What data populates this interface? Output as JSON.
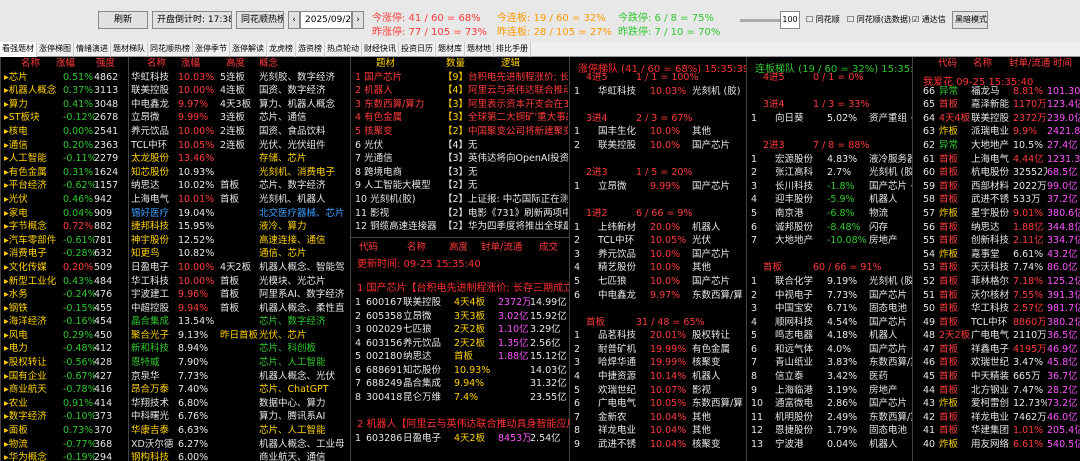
{
  "toolbar": {
    "refresh": "刷新",
    "countdown": "开盘倒计时: 17:38:13",
    "sync": "同花顺热榜",
    "date": "2025/09/25",
    "slider_value": "100",
    "cb1": "同花顺",
    "cb2": "同花顺(选数据)",
    "cb3": "通达信",
    "theme": "黑暗模式"
  },
  "stats": {
    "zt_today": "今涨停: 41 / 60 = 68%",
    "zt_yest": "昨涨停: 77 / 105 = 73%",
    "lb_today": "今连板: 19 / 60 = 32%",
    "lb_yest": "昨连板: 28 / 105 = 27%",
    "dt_today": "今跌停: 6 / 8 = 75%",
    "dt_yest": "昨跌停: 7 / 10 = 70%"
  },
  "tabs": [
    "看强题材",
    "涨停梯图",
    "情绪演进",
    "题材梯队",
    "同花顺热榜",
    "涨停季节",
    "涨停解读",
    "龙虎榜",
    "游资榜",
    "热点轮动",
    "财经快讯",
    "投资日历",
    "题材库",
    "题材地",
    "排比手册"
  ],
  "p1": {
    "headers": [
      "名称",
      "涨幅",
      "强度"
    ],
    "rows": [
      [
        "芯片",
        "0.51%",
        "4862",
        "y",
        "g"
      ],
      [
        "机器人概念",
        "0.37%",
        "3113",
        "y",
        "g"
      ],
      [
        "算力",
        "0.41%",
        "3048",
        "y",
        "g"
      ],
      [
        "ST板块",
        "-0.12%",
        "2678",
        "y",
        "g"
      ],
      [
        "核电",
        "0.00%",
        "2541",
        "y",
        "g"
      ],
      [
        "通信",
        "0.20%",
        "2363",
        "y",
        "g"
      ],
      [
        "人工智能",
        "-0.11%",
        "2279",
        "y",
        "g"
      ],
      [
        "有色金属",
        "0.31%",
        "1624",
        "y",
        "g"
      ],
      [
        "平台经济",
        "-0.62%",
        "1157",
        "y",
        "g"
      ],
      [
        "光伏",
        "0.46%",
        "942",
        "y",
        "g"
      ],
      [
        "家电",
        "0.04%",
        "909",
        "y",
        "g"
      ],
      [
        "字节概念",
        "0.72%",
        "882",
        "y",
        "r"
      ],
      [
        "汽车零部件",
        "-0.61%",
        "781",
        "y",
        "g"
      ],
      [
        "消费电子",
        "-0.28%",
        "632",
        "y",
        "g"
      ],
      [
        "文化传媒",
        "0.20%",
        "509",
        "y",
        "r"
      ],
      [
        "新型工业化",
        "0.43%",
        "484",
        "y",
        "g"
      ],
      [
        "水务",
        "-0.24%",
        "476",
        "y",
        "g"
      ],
      [
        "钢铁",
        "-0.15%",
        "455",
        "y",
        "g"
      ],
      [
        "海洋经济",
        "-0.16%",
        "454",
        "y",
        "g"
      ],
      [
        "风电",
        "0.29%",
        "450",
        "y",
        "g"
      ],
      [
        "电力",
        "-0.48%",
        "412",
        "y",
        "g"
      ],
      [
        "股权转让",
        "-0.56%",
        "428",
        "y",
        "g"
      ],
      [
        "国有企业",
        "-0.67%",
        "427",
        "y",
        "g"
      ],
      [
        "商业航天",
        "-0.78%",
        "416",
        "y",
        "g"
      ],
      [
        "农业",
        "0.91%",
        "414",
        "y",
        "g"
      ],
      [
        "数字经济",
        "-0.10%",
        "373",
        "y",
        "g"
      ],
      [
        "面板",
        "0.73%",
        "370",
        "y",
        "g"
      ],
      [
        "物流",
        "-0.77%",
        "368",
        "y",
        "g"
      ],
      [
        "华为概念",
        "-0.19%",
        "294",
        "y",
        "g"
      ]
    ]
  },
  "p2": {
    "headers": [
      "名称",
      "涨幅",
      "高度",
      "概念"
    ],
    "rows": [
      [
        "华虹科技",
        "10.03%",
        "5连板",
        "光刻胶、数字经济",
        "w",
        "r",
        "w",
        "w"
      ],
      [
        "联美控股",
        "10.00%",
        "4连板",
        "国资、数字经济",
        "w",
        "r",
        "w",
        "w"
      ],
      [
        "中电鑫龙",
        "9.97%",
        "4天3板",
        "算力、机器人概念",
        "w",
        "r",
        "w",
        "w"
      ],
      [
        "立昂微",
        "9.99%",
        "3连板",
        "芯片、通信",
        "w",
        "r",
        "w",
        "w"
      ],
      [
        "养元饮品",
        "10.00%",
        "2连板",
        "国资、食品饮料",
        "w",
        "r",
        "w",
        "w"
      ],
      [
        "TCL中环",
        "10.05%",
        "2连板",
        "光伏、光伏组件",
        "w",
        "r",
        "w",
        "w"
      ],
      [
        "太龙股份",
        "13.46%",
        "",
        "存储、芯片",
        "y",
        "r",
        "w",
        "y"
      ],
      [
        "知芯股份",
        "10.93%",
        "",
        "光刻机、消费电子",
        "y",
        "w",
        "w",
        "y"
      ],
      [
        "纳思达",
        "10.02%",
        "首板",
        "芯片、数字经济",
        "w",
        "w",
        "w",
        "w"
      ],
      [
        "上海电气",
        "10.01%",
        "首板",
        "光刻机、机器人",
        "w",
        "r",
        "w",
        "w"
      ],
      [
        "锡好医疗",
        "19.04%",
        "",
        "北交医疗器械、芯片",
        "c",
        "w",
        "w",
        "c"
      ],
      [
        "捷邦科技",
        "15.95%",
        "",
        "液冷、算力",
        "y",
        "w",
        "w",
        "y"
      ],
      [
        "神宇股份",
        "12.52%",
        "",
        "高速连接、通信",
        "y",
        "w",
        "w",
        "y"
      ],
      [
        "知更鸟",
        "10.82%",
        "",
        "通信、芯片",
        "y",
        "w",
        "w",
        "y"
      ],
      [
        "日盈电子",
        "10.00%",
        "4天2板",
        "机器人概念、智能驾",
        "w",
        "r",
        "w",
        "w"
      ],
      [
        "华工科技",
        "10.00%",
        "首板",
        "光模块、光芯片",
        "w",
        "r",
        "w",
        "w"
      ],
      [
        "宇波建工",
        "9.96%",
        "首板",
        "阿里系AI、数字经济",
        "w",
        "r",
        "w",
        "w"
      ],
      [
        "中超控股",
        "9.94%",
        "首板",
        "机器人概念、柔性直",
        "w",
        "r",
        "w",
        "w"
      ],
      [
        "晶合集成",
        "13.54%",
        "",
        "芯片、数字经济",
        "g",
        "w",
        "w",
        "g"
      ],
      [
        "聚合光子",
        "9.13%",
        "昨日首板",
        "光伏、芯片",
        "y",
        "w",
        "y",
        "y"
      ],
      [
        "新和科技",
        "8.94%",
        "",
        "芯片、科创板",
        "g",
        "w",
        "w",
        "g"
      ],
      [
        "恩特威",
        "7.90%",
        "",
        "芯片、人工智能",
        "g",
        "w",
        "w",
        "g"
      ],
      [
        "京泉华",
        "7.73%",
        "",
        "机器人概念、光伏",
        "w",
        "w",
        "w",
        "w"
      ],
      [
        "昂合万泰",
        "7.40%",
        "",
        "芯片、ChatGPT",
        "y",
        "w",
        "w",
        "y"
      ],
      [
        "华翔技术",
        "6.80%",
        "",
        "数据中心、算力",
        "w",
        "w",
        "w",
        "w"
      ],
      [
        "中科曙光",
        "6.76%",
        "",
        "算力、腾讯系AI",
        "w",
        "w",
        "w",
        "w"
      ],
      [
        "华康吉泰",
        "6.63%",
        "",
        "芯片、人工智能",
        "y",
        "w",
        "w",
        "y"
      ],
      [
        "XD沃尔德",
        "6.27%",
        "",
        "机器人概念、工业母",
        "w",
        "w",
        "w",
        "w"
      ],
      [
        "钢构科技",
        "6.00%",
        "",
        "商业航天、通信",
        "y",
        "w",
        "w",
        "w"
      ]
    ]
  },
  "p3": {
    "headers": [
      "题材",
      "数量",
      "逻辑"
    ],
    "rows": [
      [
        "国产芯片",
        "【9】",
        "台积电先进制程涨价; 长",
        "r",
        "y",
        "r"
      ],
      [
        "机器人",
        "【4】",
        "阿里云与英伟达联合推动",
        "r",
        "y",
        "r"
      ],
      [
        "东数西算/算力",
        "【3】",
        "阿里表示资本开支会在3",
        "r",
        "y",
        "r"
      ],
      [
        "有色金属",
        "【3】",
        "全球第二大铜矿'重大事故",
        "r",
        "y",
        "r"
      ],
      [
        "核聚变",
        "【2】",
        "中国聚变公司将新建聚变",
        "r",
        "y",
        "r"
      ],
      [
        "光伏",
        "【4】",
        "无",
        "w",
        "w",
        "w"
      ],
      [
        "光通信",
        "【3】",
        "英伟达将向OpenAI投资1",
        "w",
        "w",
        "w"
      ],
      [
        "跨境电商",
        "【3】",
        "无",
        "w",
        "w",
        "w"
      ],
      [
        "人工智能大模型",
        "【2】",
        "无",
        "w",
        "w",
        "w"
      ],
      [
        "光刻机(胶)",
        "【2】",
        "上证报: 中芯国际正在测",
        "w",
        "w",
        "w"
      ],
      [
        "影视",
        "【2】",
        "电影《731》刷新两项中",
        "w",
        "w",
        "w"
      ],
      [
        "铜缆高速连接器",
        "【2】",
        "华为四季度将推出全球最",
        "w",
        "w",
        "w"
      ]
    ]
  },
  "p3b": {
    "headers": [
      "代码",
      "名称",
      "高度",
      "封单/流通",
      "成交"
    ],
    "title1": "更新时间: 09-25 15:35:40",
    "title2": "1 国产芯片【台积电先进制程涨价; 长存三期成立",
    "title3": "2 机器人【阿里云与英伟达联合推动具身智能应用",
    "rows": [
      [
        "1",
        "600167",
        "联美控股",
        "4天4板",
        "2372万",
        "14.99亿"
      ],
      [
        "2",
        "605358",
        "立昂微",
        "3天3板",
        "3.02亿",
        "15.92亿"
      ],
      [
        "3",
        "002029",
        "七匹狼",
        "2天2板",
        "1.10亿",
        "3.29亿"
      ],
      [
        "4",
        "603156",
        "养元饮品",
        "2天2板",
        "1.35亿",
        "2.56亿"
      ],
      [
        "5",
        "002180",
        "纳思达",
        "首板",
        "1.88亿",
        "15.12亿"
      ],
      [
        "6",
        "688691",
        "知芯股份",
        "10.93%",
        "",
        "14.03亿"
      ],
      [
        "7",
        "688249",
        "晶合集成",
        "9.94%",
        "",
        "31.32亿"
      ],
      [
        "8",
        "300418",
        "昆仑万维",
        "7.4%",
        "",
        "23.55亿"
      ]
    ],
    "rows2": [
      [
        "1",
        "603286",
        "日盈电子",
        "4天2板",
        "8453万",
        "2.54亿"
      ]
    ]
  },
  "p4": {
    "title": "涨停梯队 (41 / 60 = 68%) 15:35:39",
    "groups": [
      {
        "label": "4进5",
        "ratio": "1 / 1 = 100%",
        "rows": [
          [
            "1",
            "华虹科技",
            "10.03%",
            "光刻机 (胶)"
          ]
        ]
      },
      {
        "label": "3进4",
        "ratio": "2 / 3 = 67%",
        "rows": [
          [
            "1",
            "国丰生化",
            "10.0%",
            "其他"
          ],
          [
            "2",
            "联美控股",
            "10.0%",
            "国产芯片"
          ]
        ]
      },
      {
        "label": "2进3",
        "ratio": "1 / 5 = 20%",
        "rows": [
          [
            "1",
            "立昂微",
            "9.99%",
            "国产芯片"
          ]
        ]
      },
      {
        "label": "1进2",
        "ratio": "6 / 66 = 9%",
        "rows": [
          [
            "1",
            "上纬新材",
            "20.0%",
            "机器人"
          ],
          [
            "2",
            "TCL中环",
            "10.05%",
            "光伏"
          ],
          [
            "3",
            "养元饮品",
            "10.0%",
            "国产芯片"
          ],
          [
            "4",
            "精艺股份",
            "10.0%",
            "其他"
          ],
          [
            "5",
            "七匹狼",
            "10.0%",
            "国产芯片"
          ],
          [
            "6",
            "中电鑫龙",
            "9.97%",
            "东数西算/算"
          ]
        ]
      },
      {
        "label": "首板",
        "ratio": "31 / 48 = 65%",
        "rows": [
          [
            "1",
            "品茗科技",
            "20.01%",
            "股权转让"
          ],
          [
            "2",
            "耐普矿机",
            "19.99%",
            "有色金属"
          ],
          [
            "3",
            "哈焊华通",
            "19.99%",
            "核聚变"
          ],
          [
            "4",
            "中捷资源",
            "10.14%",
            "机器人"
          ],
          [
            "5",
            "欢瑞世纪",
            "10.07%",
            "影视"
          ],
          [
            "6",
            "广电电气",
            "10.05%",
            "东数西算/算"
          ],
          [
            "7",
            "金新农",
            "10.04%",
            "其他"
          ],
          [
            "8",
            "祥龙电业",
            "10.04%",
            "其他"
          ],
          [
            "9",
            "武进不锈",
            "10.04%",
            "核聚变"
          ]
        ]
      }
    ]
  },
  "p5": {
    "title": "连板梯队 (19 / 60 = 32%) 15:35:39",
    "groups": [
      {
        "label": "4进5",
        "ratio": "0 / 1 = 0%",
        "rows": []
      },
      {
        "label": "3进4",
        "ratio": "1 / 3 = 33%",
        "rows": [
          [
            "1",
            "向日葵",
            "5.02%",
            "资产重组 +"
          ]
        ]
      },
      {
        "label": "2进3",
        "ratio": "7 / 8 = 88%",
        "rows": [
          [
            "1",
            "宏源股份",
            "4.83%",
            "液冷服务器"
          ],
          [
            "2",
            "张江高科",
            "2.7%",
            "光刻机 (胶"
          ],
          [
            "3",
            "长川科技",
            "-1.8%",
            "国产芯片 +"
          ],
          [
            "4",
            "迎丰股份",
            "-5.9%",
            "机器人"
          ],
          [
            "5",
            "南京港",
            "-6.8%",
            "物流"
          ],
          [
            "6",
            "诚邦股份",
            "-8.48%",
            "闪存"
          ],
          [
            "7",
            "大地地产",
            "-10.08%",
            "房地产"
          ]
        ]
      },
      {
        "label": "首板",
        "ratio": "60 / 66 = 91%",
        "rows": [
          [
            "1",
            "联合化学",
            "9.19%",
            "光刻机 (胶"
          ],
          [
            "2",
            "中视电子",
            "7.73%",
            "国产芯片"
          ],
          [
            "3",
            "中国宝安",
            "6.71%",
            "固态电池"
          ],
          [
            "4",
            "顺网科技",
            "4.54%",
            "国产芯片"
          ],
          [
            "5",
            "鸣志电器",
            "4.18%",
            "机器人"
          ],
          [
            "6",
            "和远气体",
            "4.0%",
            "国产芯片"
          ],
          [
            "7",
            "青山纸业",
            "3.83%",
            "东数西算/算"
          ],
          [
            "8",
            "信立泰",
            "3.42%",
            "医药"
          ],
          [
            "9",
            "上海临港",
            "3.19%",
            "房地产"
          ],
          [
            "10",
            "通富微电",
            "2.86%",
            "国产芯片"
          ],
          [
            "11",
            "机明股份",
            "2.49%",
            "东数西算/算"
          ],
          [
            "12",
            "恩捷股份",
            "1.79%",
            "固态电池"
          ],
          [
            "13",
            "宁波港",
            "0.04%",
            "机器人"
          ]
        ]
      }
    ]
  },
  "p6": {
    "headers": [
      "代码",
      "名称",
      "封单/流通",
      "时间"
    ],
    "title": "我爱花 09-25 15:35:40",
    "rows": [
      [
        "66",
        "异常",
        "福龙马",
        "8.81%",
        "101.30",
        "g",
        "w",
        "r"
      ],
      [
        "65",
        "首板",
        "嘉泽新能",
        "1170万",
        "123.4亿",
        "r",
        "w",
        "r"
      ],
      [
        "64",
        "4天4板",
        "联美控股",
        "2372万",
        "239.0亿",
        "r",
        "w",
        "r"
      ],
      [
        "63",
        "炸板",
        "派瑞电业",
        "9.9%",
        "2421.8",
        "y",
        "w",
        "r"
      ],
      [
        "62",
        "异常",
        "大地地产",
        "10.5%",
        "27.4亿",
        "g",
        "w",
        "w"
      ],
      [
        "61",
        "首板",
        "上海电气",
        "4.44亿",
        "1231.3",
        "r",
        "w",
        "r"
      ],
      [
        "60",
        "首板",
        "杭电股份",
        "32552万",
        "68.5亿",
        "r",
        "w",
        "w"
      ],
      [
        "59",
        "首板",
        "西部材料",
        "2022万",
        "99.0亿",
        "r",
        "w",
        "w"
      ],
      [
        "58",
        "首板",
        "武进不锈",
        "533万",
        "37.2亿",
        "r",
        "w",
        "w"
      ],
      [
        "57",
        "炸板",
        "星宇股份",
        "9.01%",
        "380.6亿",
        "y",
        "w",
        "r"
      ],
      [
        "56",
        "首板",
        "纳思达",
        "1.88亿",
        "344.8亿",
        "r",
        "w",
        "r"
      ],
      [
        "55",
        "首板",
        "创新科技",
        "2.11亿",
        "334.7亿",
        "r",
        "w",
        "r"
      ],
      [
        "54",
        "炸板",
        "嘉事堂",
        "6.61%",
        "43.2亿",
        "y",
        "w",
        "w"
      ],
      [
        "53",
        "首板",
        "天沃科技",
        "7.74%",
        "86.0亿",
        "r",
        "w",
        "w"
      ],
      [
        "52",
        "首板",
        "菲林格尔",
        "7.18%",
        "125.2亿",
        "r",
        "w",
        "r"
      ],
      [
        "51",
        "首板",
        "沃尔核材",
        "7.55%",
        "391.3亿",
        "r",
        "w",
        "r"
      ],
      [
        "50",
        "首板",
        "华工科技",
        "2.57亿",
        "981.7亿",
        "r",
        "w",
        "r"
      ],
      [
        "49",
        "首板",
        "TCL中环",
        "8860万",
        "380.2亿",
        "r",
        "w",
        "r"
      ],
      [
        "48",
        "2天2板",
        "广电电气",
        "2110万",
        "36.5亿",
        "r",
        "w",
        "w"
      ],
      [
        "47",
        "首板",
        "祥鑫电子",
        "4195万",
        "46.9亿",
        "r",
        "w",
        "r"
      ],
      [
        "46",
        "首板",
        "欢瑞世纪",
        "3.47%",
        "45.8亿",
        "r",
        "w",
        "w"
      ],
      [
        "45",
        "首板",
        "中天精装",
        "665万",
        "36.7亿",
        "r",
        "w",
        "w"
      ],
      [
        "44",
        "首板",
        "北方钢业",
        "7.47%",
        "28.2亿",
        "r",
        "w",
        "w"
      ],
      [
        "43",
        "炸板",
        "爱柯雷创",
        "12.73%",
        "73.2亿",
        "y",
        "w",
        "w"
      ],
      [
        "42",
        "首板",
        "祥龙电业",
        "7462万",
        "46.0亿",
        "r",
        "w",
        "w"
      ],
      [
        "41",
        "首板",
        "华建集团",
        "1.01%",
        "205.4亿",
        "r",
        "w",
        "r"
      ],
      [
        "40",
        "炸板",
        "用友网络",
        "6.61%",
        "540.5亿",
        "y",
        "w",
        "r"
      ]
    ]
  }
}
